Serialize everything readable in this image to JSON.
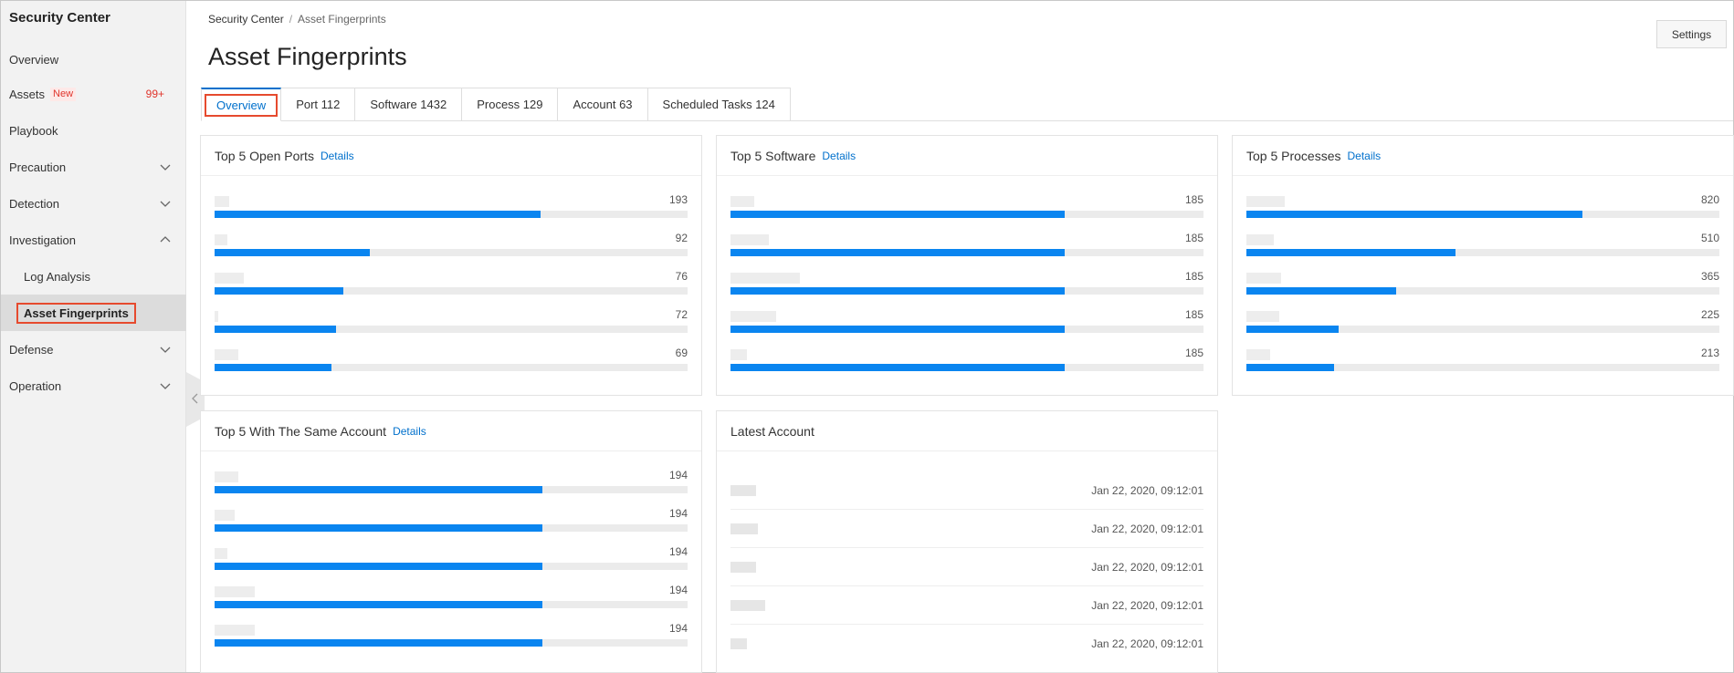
{
  "sidebar": {
    "title": "Security Center",
    "items": [
      {
        "label": "Overview"
      },
      {
        "label": "Assets",
        "badge": "New",
        "count": "99+"
      },
      {
        "label": "Playbook"
      },
      {
        "label": "Precaution"
      },
      {
        "label": "Detection"
      },
      {
        "label": "Investigation"
      },
      {
        "label": "Log Analysis"
      },
      {
        "label": "Asset Fingerprints"
      },
      {
        "label": "Defense"
      },
      {
        "label": "Operation"
      }
    ]
  },
  "header": {
    "breadcrumb": [
      "Security Center",
      "/",
      "Asset Fingerprints"
    ],
    "title": "Asset Fingerprints",
    "settings_label": "Settings"
  },
  "tabs": [
    {
      "label": "Overview"
    },
    {
      "label": "Port 112"
    },
    {
      "label": "Software 1432"
    },
    {
      "label": "Process 129"
    },
    {
      "label": "Account 63"
    },
    {
      "label": "Scheduled Tasks 124"
    }
  ],
  "cards": {
    "ports": {
      "title": "Top 5 Open Ports",
      "details": "Details",
      "max": 280,
      "values": [
        "193",
        "92",
        "76",
        "72",
        "69"
      ]
    },
    "software": {
      "title": "Top 5 Software",
      "details": "Details",
      "max": 262,
      "values": [
        "185",
        "185",
        "185",
        "185",
        "185"
      ]
    },
    "processes": {
      "title": "Top 5 Processes",
      "details": "Details",
      "max": 1154,
      "values": [
        "820",
        "510",
        "365",
        "225",
        "213"
      ]
    },
    "accounts": {
      "title": "Top 5 With The Same Account",
      "details": "Details",
      "max": 280,
      "values": [
        "194",
        "194",
        "194",
        "194",
        "194"
      ]
    },
    "latest": {
      "title": "Latest Account",
      "times": [
        "Jan 22, 2020, 09:12:01",
        "Jan 22, 2020, 09:12:01",
        "Jan 22, 2020, 09:12:01",
        "Jan 22, 2020, 09:12:01",
        "Jan 22, 2020, 09:12:01"
      ]
    }
  },
  "colors": {
    "accent": "#0070cc",
    "bar": "#0a85f0",
    "highlight": "#e64a2e",
    "badge": "#e0352c"
  }
}
